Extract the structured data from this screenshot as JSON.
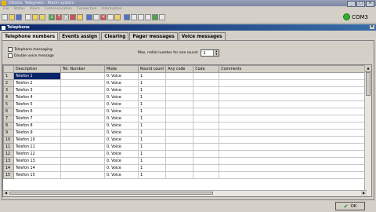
{
  "window": {
    "title": "Ditools, Telegreen - Alarm system"
  },
  "menu": [
    "File",
    "Status",
    "Users",
    "Communication",
    "Connection",
    "Information"
  ],
  "toolbar": {
    "buttons": [
      "new-icon",
      "open-icon",
      "save-icon",
      "print-icon",
      "copy-icon",
      "paste-icon",
      "read-icon",
      "write-icon",
      "refresh-icon",
      "stop-icon",
      "config-icon",
      "phone-icon",
      "exit-icon",
      "grid-icon",
      "calc-icon",
      "help-icon",
      "info-icon",
      "settings-icon",
      "close-icon",
      "table-icon",
      "doc-icon",
      "lock-icon"
    ]
  },
  "com": {
    "label": "COM3",
    "status_color": "#30b030"
  },
  "panel": {
    "title": "Telephone"
  },
  "tabs": [
    "Telephone numbers",
    "Events assign",
    "Clearing",
    "Pager messages",
    "Voice messages"
  ],
  "options": {
    "telephone_messaging": "Telephone messaging",
    "double_voice": "Double voice message"
  },
  "redial": {
    "label": "Max. redial number for one round:",
    "value": "1"
  },
  "table": {
    "columns": [
      "",
      "Description",
      "Tel. Number",
      "Mode",
      "Round count",
      "Any code",
      "Code",
      "Comments"
    ],
    "rows": [
      [
        "1",
        "Telefon 1",
        "",
        "0. Voice",
        "1",
        "",
        "",
        ""
      ],
      [
        "2",
        "Telefon 2",
        "",
        "0. Voice",
        "1",
        "",
        "",
        ""
      ],
      [
        "3",
        "Telefon 3",
        "",
        "0. Voice",
        "1",
        "",
        "",
        ""
      ],
      [
        "4",
        "Telefon 4",
        "",
        "0. Voice",
        "1",
        "",
        "",
        ""
      ],
      [
        "5",
        "Telefon 5",
        "",
        "0. Voice",
        "1",
        "",
        "",
        ""
      ],
      [
        "6",
        "Telefon 6",
        "",
        "0. Voice",
        "1",
        "",
        "",
        ""
      ],
      [
        "7",
        "Telefon 7",
        "",
        "0. Voice",
        "1",
        "",
        "",
        ""
      ],
      [
        "8",
        "Telefon 8",
        "",
        "0. Voice",
        "1",
        "",
        "",
        ""
      ],
      [
        "9",
        "Telefon 9",
        "",
        "0. Voice",
        "1",
        "",
        "",
        ""
      ],
      [
        "10",
        "Telefon 10",
        "",
        "0. Voice",
        "1",
        "",
        "",
        ""
      ],
      [
        "11",
        "Telefon 11",
        "",
        "0. Voice",
        "1",
        "",
        "",
        ""
      ],
      [
        "12",
        "Telefon 12",
        "",
        "0. Voice",
        "1",
        "",
        "",
        ""
      ],
      [
        "13",
        "Telefon 13",
        "",
        "0. Voice",
        "1",
        "",
        "",
        ""
      ],
      [
        "14",
        "Telefon 14",
        "",
        "0. Voice",
        "1",
        "",
        "",
        ""
      ],
      [
        "15",
        "Telefon 15",
        "",
        "0. Voice",
        "1",
        "",
        "",
        ""
      ]
    ]
  },
  "ok": {
    "label": "OK"
  }
}
